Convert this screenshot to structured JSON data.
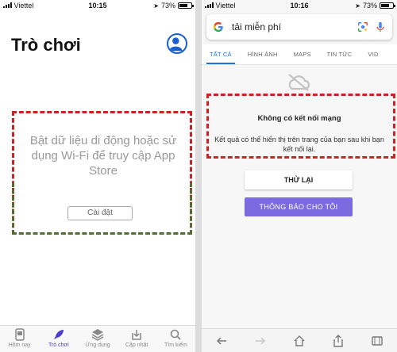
{
  "left": {
    "status": {
      "carrier": "Viettel",
      "time": "10:15",
      "battery": "73%",
      "battery_level": 0.73
    },
    "title": "Trò chơi",
    "message": "Bật dữ liệu di động hoặc sử dụng Wi-Fi để truy cập App Store",
    "settings_button": "Cài đặt",
    "tabs": [
      {
        "label": "Hôm nay",
        "icon": "today-icon"
      },
      {
        "label": "Trò chơi",
        "icon": "rocket-icon"
      },
      {
        "label": "Ứng dụng",
        "icon": "apps-stack-icon"
      },
      {
        "label": "Cập nhật",
        "icon": "updates-icon"
      },
      {
        "label": "Tìm kiếm",
        "icon": "search-icon"
      }
    ],
    "accent": "#4b3fc9",
    "highlight_colors": [
      "#cc2222",
      "#556b2f"
    ]
  },
  "right": {
    "status": {
      "carrier": "Viettel",
      "time": "10:16",
      "battery": "73%",
      "battery_level": 0.73
    },
    "query": "tải miễn phí",
    "tabs": [
      "TẤT CẢ",
      "HÌNH ẢNH",
      "MAPS",
      "TIN TỨC",
      "VID"
    ],
    "error_title": "Không có kết nối mạng",
    "error_desc": "Kết quả có thể hiển thị trên trang của bạn sau khi bạn kết nối lại.",
    "retry_button": "THỬ LẠI",
    "notify_button": "THÔNG BÁO CHO TÔI",
    "accent": "#1a73e8",
    "notify_color": "#7c6be0"
  }
}
